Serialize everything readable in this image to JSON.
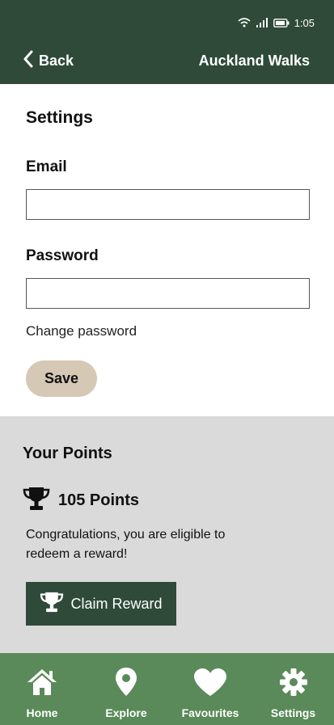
{
  "status_bar": {
    "time": "1:05"
  },
  "header": {
    "back_label": "Back",
    "title": "Auckland Walks"
  },
  "settings": {
    "title": "Settings",
    "email_label": "Email",
    "email_value": "",
    "password_label": "Password",
    "password_value": "",
    "change_password": "Change password",
    "save_label": "Save"
  },
  "points": {
    "title": "Your Points",
    "value": "105 Points",
    "message": "Congratulations, you are eligible to redeem a reward!",
    "claim_label": "Claim Reward"
  },
  "tabs": [
    {
      "label": "Home",
      "icon": "home-icon"
    },
    {
      "label": "Explore",
      "icon": "map-pin-icon"
    },
    {
      "label": "Favourites",
      "icon": "heart-icon"
    },
    {
      "label": "Settings",
      "icon": "gear-icon"
    }
  ],
  "colors": {
    "header_bg": "#2f4a39",
    "tabbar_bg": "#5a8a59",
    "save_button_bg": "#d5c8b4",
    "points_bg": "#dadada"
  }
}
